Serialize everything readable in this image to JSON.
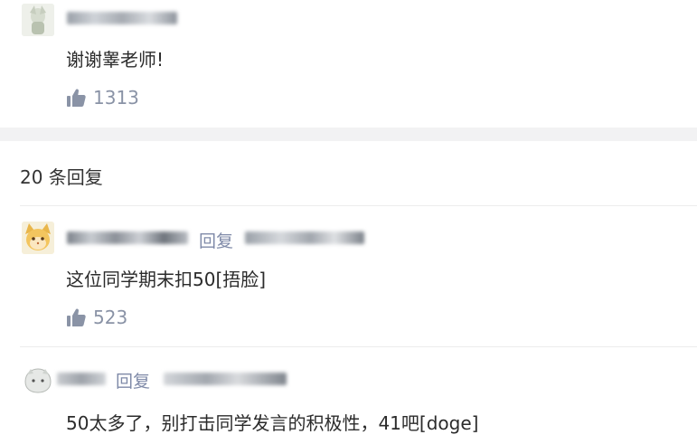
{
  "main_comment": {
    "text": "谢谢睾老师!",
    "likes": "1313"
  },
  "replies_header": {
    "count_label": "20 条回复"
  },
  "replies": [
    {
      "reply_label": "回复",
      "text": "这位同学期末扣50[捂脸]",
      "likes": "523"
    },
    {
      "reply_label": "回复",
      "text": "50太多了，别打击同学发言的积极性，41吧[doge]"
    }
  ],
  "icons": {
    "like": "thumbs-up-icon"
  },
  "colors": {
    "meta": "#8a93a6",
    "reply_link": "#7f8aa8",
    "separator": "#f2f2f3"
  }
}
